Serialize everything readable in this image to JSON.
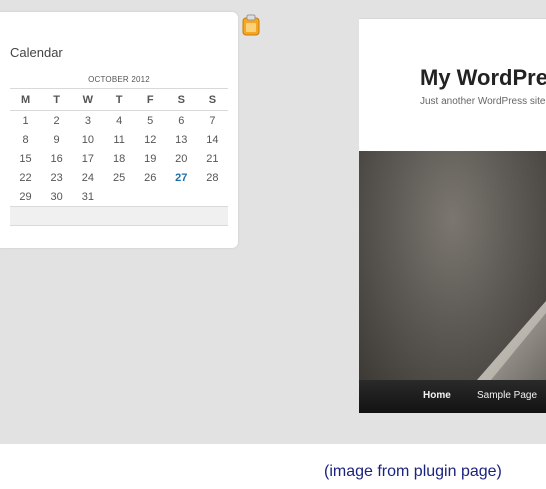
{
  "widget": {
    "title": "Calendar",
    "icon": "clipboard-icon",
    "calendar": {
      "caption": "OCTOBER 2012",
      "weekdays": [
        "M",
        "T",
        "W",
        "T",
        "F",
        "S",
        "S"
      ],
      "weeks": [
        [
          "1",
          "2",
          "3",
          "4",
          "5",
          "6",
          "7"
        ],
        [
          "8",
          "9",
          "10",
          "11",
          "12",
          "13",
          "14"
        ],
        [
          "15",
          "16",
          "17",
          "18",
          "19",
          "20",
          "21"
        ],
        [
          "22",
          "23",
          "24",
          "25",
          "26",
          "27",
          "28"
        ],
        [
          "29",
          "30",
          "31",
          "",
          "",
          "",
          ""
        ]
      ],
      "today": "27",
      "today_color": "#1f6fa8"
    }
  },
  "site": {
    "title": "My WordPress",
    "tagline": "Just another WordPress site",
    "nav": [
      "Home",
      "Sample Page"
    ]
  },
  "caption": "(image from plugin page)",
  "colors": {
    "backdrop": "#e2e2e2",
    "caption": "#1a237e",
    "navbar": "#1a1a1a"
  }
}
